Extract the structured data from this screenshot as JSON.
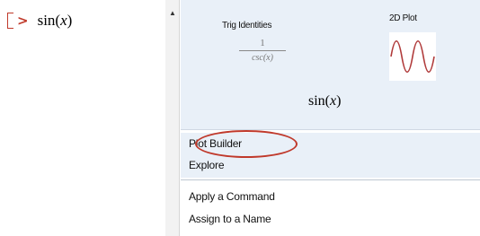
{
  "worksheet": {
    "input_func": "sin",
    "input_open": "(",
    "input_var": "x",
    "input_close": ")",
    "prompt_symbol": ">"
  },
  "context_panel": {
    "preview": {
      "trig_identities_label": "Trig Identities",
      "fraction_numerator": "1",
      "fraction_denominator": "csc(x)",
      "plot_label": "2D Plot",
      "result_func": "sin",
      "result_open": "(",
      "result_var": "x",
      "result_close": ")"
    },
    "menu_items": [
      {
        "label": "Plot Builder"
      },
      {
        "label": "Explore"
      },
      {
        "label": "Apply a Command"
      },
      {
        "label": "Assign to a Name"
      }
    ]
  },
  "colors": {
    "accent_red": "#c0392b",
    "panel_blue": "#e9f0f8",
    "plot_curve": "#b03a3a"
  },
  "icons": {
    "scroll_up": "triangle-up-icon",
    "plot_thumbnail": "sine-wave-icon"
  }
}
